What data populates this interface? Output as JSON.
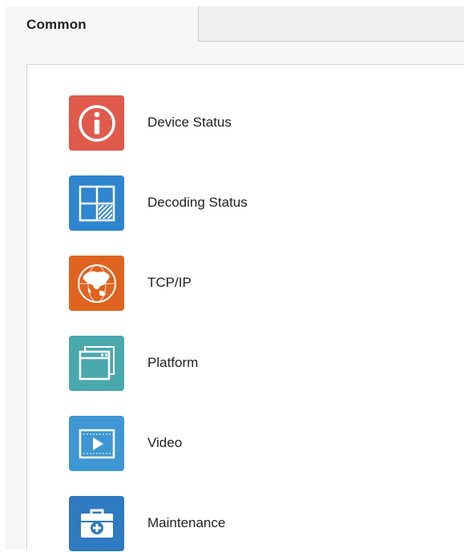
{
  "tabs": [
    {
      "label": "Common",
      "active": true
    }
  ],
  "menu": {
    "items": [
      {
        "label": "Device Status",
        "icon": "info-icon",
        "color": "#e05a4c"
      },
      {
        "label": "Decoding Status",
        "icon": "grid-icon",
        "color": "#2f86cf"
      },
      {
        "label": "TCP/IP",
        "icon": "globe-icon",
        "color": "#e0631f"
      },
      {
        "label": "Platform",
        "icon": "window-icon",
        "color": "#4aa9ad"
      },
      {
        "label": "Video",
        "icon": "video-icon",
        "color": "#3e97d3"
      },
      {
        "label": "Maintenance",
        "icon": "toolbox-icon",
        "color": "#2f7ac0"
      }
    ]
  }
}
